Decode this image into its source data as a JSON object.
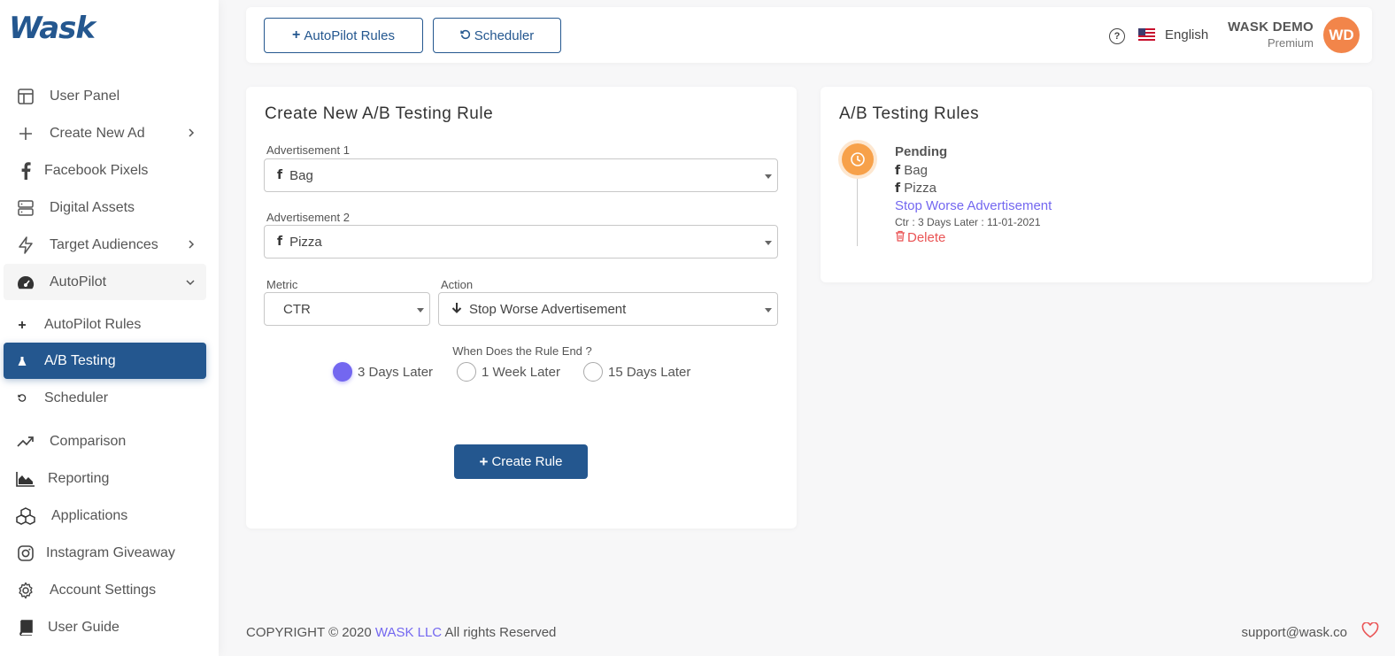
{
  "brand": {
    "logo_text": "Wask"
  },
  "sidebar": {
    "items": [
      {
        "label": "User Panel",
        "icon": "layout-icon"
      },
      {
        "label": "Create New Ad",
        "icon": "plus-icon"
      },
      {
        "label": "Facebook Pixels",
        "icon": "facebook-icon"
      },
      {
        "label": "Digital Assets",
        "icon": "server-icon"
      },
      {
        "label": "Target Audiences",
        "icon": "zap-icon"
      },
      {
        "label": "AutoPilot",
        "icon": "dashboard-icon"
      },
      {
        "label": "AutoPilot Rules",
        "icon": "plus-icon"
      },
      {
        "label": "A/B Testing",
        "icon": "flask-icon"
      },
      {
        "label": "Scheduler",
        "icon": "history-icon"
      },
      {
        "label": "Comparison",
        "icon": "trending-up-icon"
      },
      {
        "label": "Reporting",
        "icon": "area-chart-icon"
      },
      {
        "label": "Applications",
        "icon": "cubes-icon"
      },
      {
        "label": "Instagram Giveaway",
        "icon": "instagram-icon"
      },
      {
        "label": "Account Settings",
        "icon": "gear-icon"
      },
      {
        "label": "User Guide",
        "icon": "book-icon"
      }
    ]
  },
  "topbar": {
    "autopilot_rules_label": "AutoPilot Rules",
    "scheduler_label": "Scheduler",
    "language": "English",
    "user_name": "WASK DEMO",
    "user_role": "Premium",
    "avatar_initials": "WD"
  },
  "create_form": {
    "title": "Create New A/B Testing Rule",
    "ad1_label": "Advertisement 1",
    "ad1_value": "Bag",
    "ad2_label": "Advertisement 2",
    "ad2_value": "Pizza",
    "metric_label": "Metric",
    "metric_value": "CTR",
    "action_label": "Action",
    "action_value": "Stop Worse Advertisement",
    "end_question": "When Does the Rule End ?",
    "end_options": [
      "3 Days Later",
      "1 Week Later",
      "15 Days Later"
    ],
    "selected_option": "3 Days Later",
    "submit_label": "Create Rule"
  },
  "rules_panel": {
    "title": "A/B Testing Rules",
    "rules": [
      {
        "status": "Pending",
        "ad1": "Bag",
        "ad2": "Pizza",
        "action": "Stop Worse Advertisement",
        "detail": "Ctr : 3 Days Later : 11-01-2021",
        "delete_label": "Delete"
      }
    ]
  },
  "footer": {
    "copyright_prefix": "COPYRIGHT © 2020",
    "company": "WASK LLC",
    "copyright_suffix": "All rights Reserved",
    "support_email": "support@wask.co"
  },
  "colors": {
    "primary": "#24578f",
    "accent": "#7367f0",
    "avatar": "#f2854a",
    "pending": "#f7a14a",
    "danger": "#ea5455"
  }
}
